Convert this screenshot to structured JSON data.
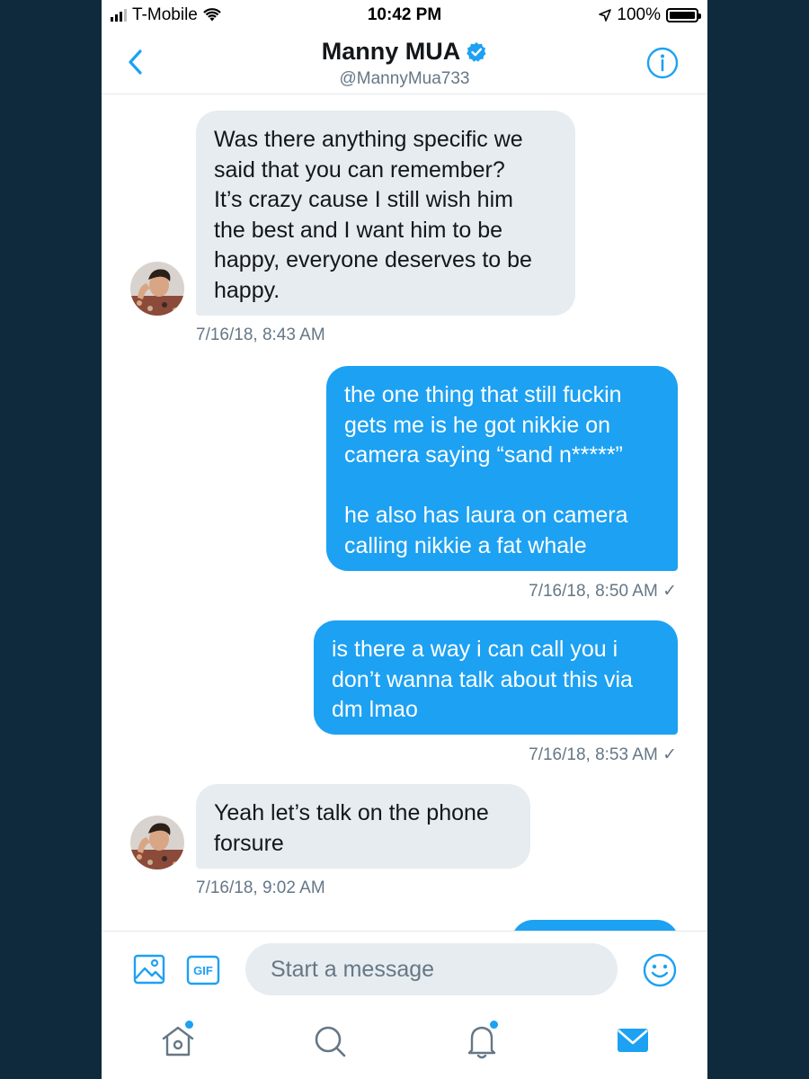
{
  "status_bar": {
    "carrier": "T-Mobile",
    "time": "10:42 PM",
    "battery": "100%"
  },
  "header": {
    "name": "Manny MUA",
    "handle": "@MannyMua733"
  },
  "messages": [
    {
      "side": "in",
      "text": "Was there anything specific we\nsaid that you can remember?\nIt’s crazy cause I still wish him\nthe best and I want him to be\nhappy, everyone deserves to be\nhappy.",
      "timestamp": "7/16/18, 8:43 AM"
    },
    {
      "side": "out",
      "text": "the one thing that still fuckin\ngets me is he got nikkie on\ncamera saying “sand n*****”\n\nhe also has laura on camera\ncalling nikkie a fat whale",
      "timestamp": "7/16/18, 8:50 AM ✓"
    },
    {
      "side": "out",
      "text": "is there a way i can call you i\ndon’t wanna talk about this via\ndm lmao",
      "timestamp": "7/16/18, 8:53 AM ✓"
    },
    {
      "side": "in",
      "text": "Yeah let’s talk on the phone\nforsure",
      "timestamp": "7/16/18, 9:02 AM"
    }
  ],
  "composer": {
    "placeholder": "Start a message",
    "gif_label": "GIF"
  },
  "colors": {
    "accent": "#1da1f2",
    "incoming_bubble": "#e6ecf0",
    "muted_text": "#657786",
    "background_frame": "#0f2a3d"
  },
  "icons": {
    "back": "chevron-left-icon",
    "info": "info-icon",
    "verified": "verified-badge-icon",
    "image": "image-icon",
    "gif": "gif-icon",
    "emoji": "emoji-icon",
    "home": "home-icon",
    "search": "search-icon",
    "notifications": "bell-icon",
    "messages": "mail-icon"
  }
}
